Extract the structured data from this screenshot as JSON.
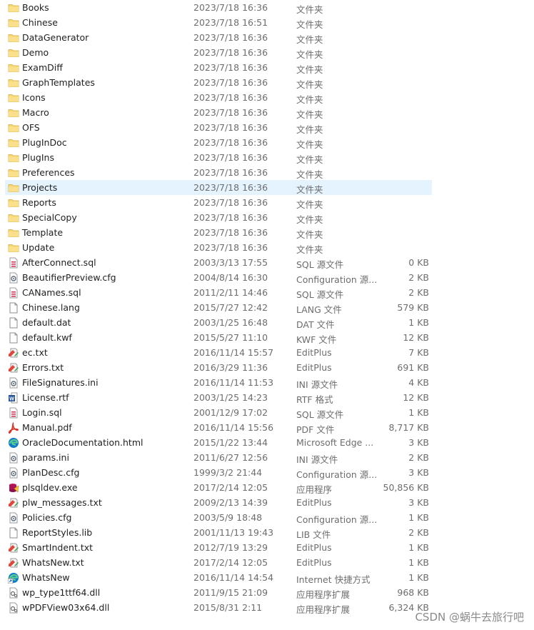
{
  "rows": [
    {
      "name": "Books",
      "date": "2023/7/18 16:36",
      "type": "文件夹",
      "size": "",
      "icon": "folder-icon"
    },
    {
      "name": "Chinese",
      "date": "2023/7/18 16:51",
      "type": "文件夹",
      "size": "",
      "icon": "folder-icon"
    },
    {
      "name": "DataGenerator",
      "date": "2023/7/18 16:36",
      "type": "文件夹",
      "size": "",
      "icon": "folder-icon"
    },
    {
      "name": "Demo",
      "date": "2023/7/18 16:36",
      "type": "文件夹",
      "size": "",
      "icon": "folder-icon"
    },
    {
      "name": "ExamDiff",
      "date": "2023/7/18 16:36",
      "type": "文件夹",
      "size": "",
      "icon": "folder-icon"
    },
    {
      "name": "GraphTemplates",
      "date": "2023/7/18 16:36",
      "type": "文件夹",
      "size": "",
      "icon": "folder-icon"
    },
    {
      "name": "Icons",
      "date": "2023/7/18 16:36",
      "type": "文件夹",
      "size": "",
      "icon": "folder-icon"
    },
    {
      "name": "Macro",
      "date": "2023/7/18 16:36",
      "type": "文件夹",
      "size": "",
      "icon": "folder-icon"
    },
    {
      "name": "OFS",
      "date": "2023/7/18 16:36",
      "type": "文件夹",
      "size": "",
      "icon": "folder-icon"
    },
    {
      "name": "PlugInDoc",
      "date": "2023/7/18 16:36",
      "type": "文件夹",
      "size": "",
      "icon": "folder-icon"
    },
    {
      "name": "PlugIns",
      "date": "2023/7/18 16:36",
      "type": "文件夹",
      "size": "",
      "icon": "folder-icon"
    },
    {
      "name": "Preferences",
      "date": "2023/7/18 16:36",
      "type": "文件夹",
      "size": "",
      "icon": "folder-icon"
    },
    {
      "name": "Projects",
      "date": "2023/7/18 16:36",
      "type": "文件夹",
      "size": "",
      "icon": "folder-icon",
      "selected": true
    },
    {
      "name": "Reports",
      "date": "2023/7/18 16:36",
      "type": "文件夹",
      "size": "",
      "icon": "folder-icon"
    },
    {
      "name": "SpecialCopy",
      "date": "2023/7/18 16:36",
      "type": "文件夹",
      "size": "",
      "icon": "folder-icon"
    },
    {
      "name": "Template",
      "date": "2023/7/18 16:36",
      "type": "文件夹",
      "size": "",
      "icon": "folder-icon"
    },
    {
      "name": "Update",
      "date": "2023/7/18 16:36",
      "type": "文件夹",
      "size": "",
      "icon": "folder-icon"
    },
    {
      "name": "AfterConnect.sql",
      "date": "2003/3/13 17:55",
      "type": "SQL 源文件",
      "size": "0 KB",
      "icon": "sql-file-icon"
    },
    {
      "name": "BeautifierPreview.cfg",
      "date": "2004/8/14 16:30",
      "type": "Configuration 源...",
      "size": "2 KB",
      "icon": "config-file-icon"
    },
    {
      "name": "CANames.sql",
      "date": "2011/2/11 14:46",
      "type": "SQL 源文件",
      "size": "2 KB",
      "icon": "sql-file-icon"
    },
    {
      "name": "Chinese.lang",
      "date": "2015/7/27 12:42",
      "type": "LANG 文件",
      "size": "579 KB",
      "icon": "blank-file-icon"
    },
    {
      "name": "default.dat",
      "date": "2003/1/25 16:48",
      "type": "DAT 文件",
      "size": "1 KB",
      "icon": "blank-file-icon"
    },
    {
      "name": "default.kwf",
      "date": "2015/5/27 11:10",
      "type": "KWF 文件",
      "size": "12 KB",
      "icon": "blank-file-icon"
    },
    {
      "name": "ec.txt",
      "date": "2016/11/14 15:57",
      "type": "EditPlus",
      "size": "7 KB",
      "icon": "editplus-icon"
    },
    {
      "name": "Errors.txt",
      "date": "2016/3/29 11:36",
      "type": "EditPlus",
      "size": "691 KB",
      "icon": "editplus-icon"
    },
    {
      "name": "FileSignatures.ini",
      "date": "2016/11/14 11:53",
      "type": "INI 源文件",
      "size": "4 KB",
      "icon": "config-file-icon"
    },
    {
      "name": "License.rtf",
      "date": "2003/1/25 14:23",
      "type": "RTF 格式",
      "size": "12 KB",
      "icon": "word-file-icon"
    },
    {
      "name": "Login.sql",
      "date": "2001/12/9 17:02",
      "type": "SQL 源文件",
      "size": "1 KB",
      "icon": "sql-file-icon"
    },
    {
      "name": "Manual.pdf",
      "date": "2016/11/14 15:56",
      "type": "PDF 文件",
      "size": "8,717 KB",
      "icon": "pdf-icon"
    },
    {
      "name": "OracleDocumentation.html",
      "date": "2015/1/22 13:44",
      "type": "Microsoft Edge ...",
      "size": "3 KB",
      "icon": "edge-icon"
    },
    {
      "name": "params.ini",
      "date": "2011/6/27 12:56",
      "type": "INI 源文件",
      "size": "2 KB",
      "icon": "config-file-icon"
    },
    {
      "name": "PlanDesc.cfg",
      "date": "1999/3/2 21:44",
      "type": "Configuration 源...",
      "size": "3 KB",
      "icon": "config-file-icon"
    },
    {
      "name": "plsqldev.exe",
      "date": "2017/2/14 12:05",
      "type": "应用程序",
      "size": "50,856 KB",
      "icon": "app-exe-icon"
    },
    {
      "name": "plw_messages.txt",
      "date": "2009/2/13 14:39",
      "type": "EditPlus",
      "size": "3 KB",
      "icon": "editplus-icon"
    },
    {
      "name": "Policies.cfg",
      "date": "2003/5/9 18:48",
      "type": "Configuration 源...",
      "size": "1 KB",
      "icon": "config-file-icon"
    },
    {
      "name": "ReportStyles.lib",
      "date": "2001/11/13 19:43",
      "type": "LIB 文件",
      "size": "2 KB",
      "icon": "blank-file-icon"
    },
    {
      "name": "SmartIndent.txt",
      "date": "2012/7/19 13:29",
      "type": "EditPlus",
      "size": "1 KB",
      "icon": "editplus-icon"
    },
    {
      "name": "WhatsNew.txt",
      "date": "2017/2/14 12:05",
      "type": "EditPlus",
      "size": "1 KB",
      "icon": "editplus-icon"
    },
    {
      "name": "WhatsNew",
      "date": "2016/11/14 14:54",
      "type": "Internet 快捷方式",
      "size": "1 KB",
      "icon": "edge-shortcut-icon"
    },
    {
      "name": "wp_type1ttf64.dll",
      "date": "2011/9/15 21:09",
      "type": "应用程序扩展",
      "size": "968 KB",
      "icon": "dll-icon"
    },
    {
      "name": "wPDFView03x64.dll",
      "date": "2015/8/31 2:11",
      "type": "应用程序扩展",
      "size": "6,324 KB",
      "icon": "dll-icon"
    }
  ],
  "watermark": "CSDN @蜗牛去旅行吧",
  "colors": {
    "selection": "#e5f3ff",
    "folder": "#f8d775",
    "sql": "#d2365c",
    "pdf": "#d93025",
    "edge": "#0f7bc8",
    "word": "#2b579a"
  }
}
